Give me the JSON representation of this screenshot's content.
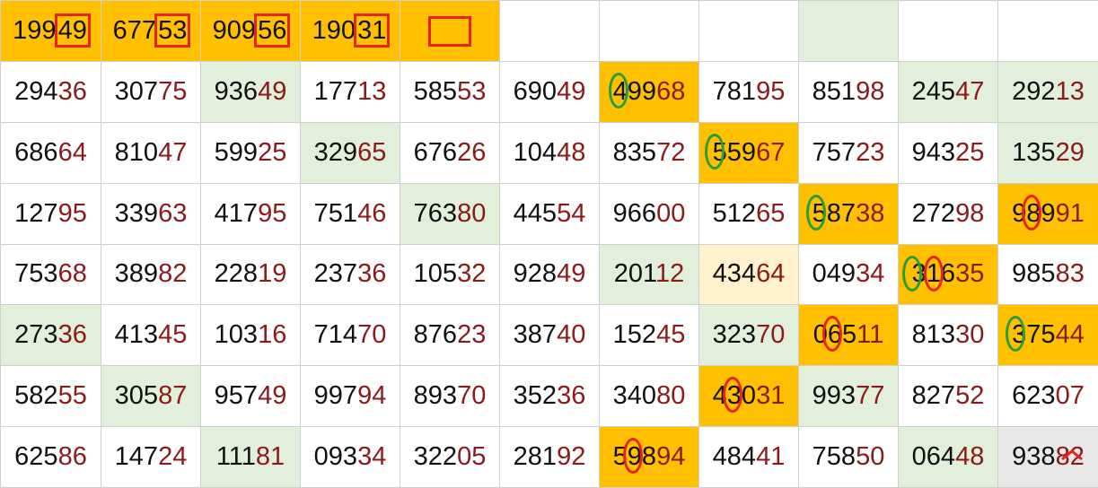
{
  "header": [
    "19949",
    "67753",
    "90956",
    "19031",
    "",
    "",
    "",
    "",
    "",
    ""
  ],
  "rows": [
    [
      "29436",
      "30775",
      "93649",
      "17713",
      "58553",
      "69049",
      "49968",
      "78195",
      "85198",
      "24547",
      "29213"
    ],
    [
      "68664",
      "81047",
      "59925",
      "32965",
      "67626",
      "10448",
      "83572",
      "55967",
      "75723",
      "94325",
      "13529"
    ],
    [
      "12795",
      "33963",
      "41795",
      "75146",
      "76380",
      "44554",
      "96600",
      "51265",
      "58738",
      "27298",
      "98991"
    ],
    [
      "75368",
      "38982",
      "22819",
      "23736",
      "10532",
      "92849",
      "20112",
      "43464",
      "04934",
      "31635",
      "98583"
    ],
    [
      "27336",
      "41345",
      "10316",
      "71470",
      "87623",
      "38740",
      "15245",
      "32370",
      "06511",
      "81330",
      "37544"
    ],
    [
      "58255",
      "30587",
      "95749",
      "99794",
      "89370",
      "35236",
      "34080",
      "43031",
      "99377",
      "82752",
      "62307"
    ],
    [
      "62586",
      "14724",
      "11181",
      "09334",
      "32205",
      "28192",
      "59894",
      "48441",
      "75850",
      "06448",
      "93882"
    ]
  ],
  "colors": {
    "orange": "#ffc000",
    "light_green": "#e2efda",
    "light_yellow": "#fff2cc",
    "tail_red": "#8b1a1a",
    "marker_red": "#e8231b",
    "marker_green": "#2a9d3a"
  },
  "icons": {
    "corner": "caret-up-icon"
  }
}
